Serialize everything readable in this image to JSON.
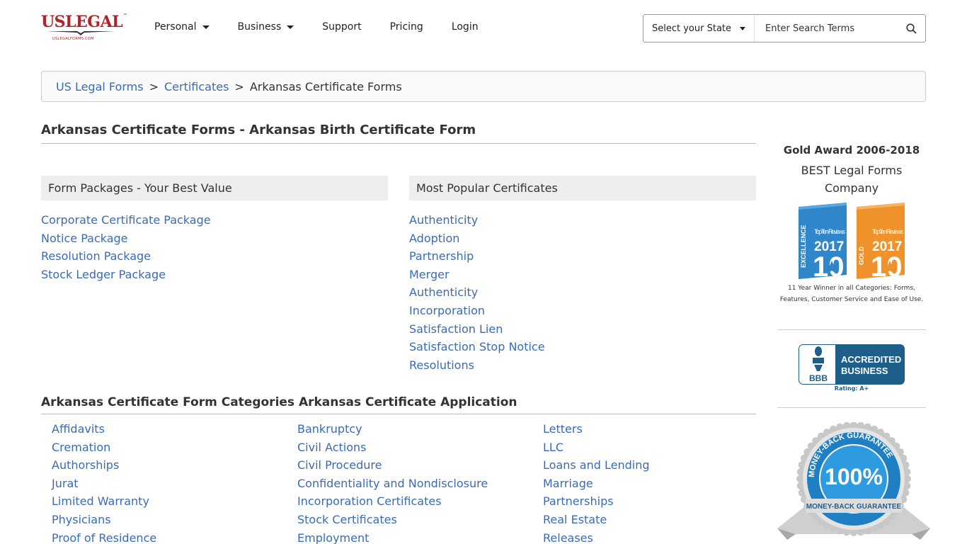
{
  "header": {
    "logo": {
      "text": "USLEGAL",
      "tm": "™",
      "sub": "USLEGALFORMS.COM"
    },
    "nav": [
      {
        "label": "Personal",
        "dropdown": true
      },
      {
        "label": "Business",
        "dropdown": true
      },
      {
        "label": "Support",
        "dropdown": false
      },
      {
        "label": "Pricing",
        "dropdown": false
      },
      {
        "label": "Login",
        "dropdown": false
      }
    ],
    "state_select": "Select your State",
    "search_placeholder": "Enter Search Terms",
    "search_icon": "search-icon"
  },
  "breadcrumb": {
    "items": [
      "US Legal Forms",
      "Certificates"
    ],
    "separator": ">",
    "current": "Arkansas Certificate Forms"
  },
  "main": {
    "title": "Arkansas Certificate Forms - Arkansas Birth Certificate Form",
    "packages": {
      "heading": "Form Packages - Your Best Value",
      "items": [
        "Corporate Certificate Package",
        "Notice Package",
        "Resolution Package",
        "Stock Ledger Package"
      ]
    },
    "popular": {
      "heading": "Most Popular Certificates",
      "items": [
        "Authenticity",
        "Adoption",
        "Partnership",
        "Merger",
        "Authenticity",
        "Incorporation",
        "Satisfaction Lien",
        "Satisfaction Stop Notice",
        "Resolutions"
      ]
    },
    "categories": {
      "heading": "Arkansas Certificate Form Categories Arkansas Certificate Application",
      "col1": [
        "Affidavits",
        "Cremation",
        "Authorships",
        "Jurat",
        "Limited Warranty",
        "Physicians",
        "Proof of Residence"
      ],
      "col2": [
        "Bankruptcy",
        "Civil Actions",
        "Civil Procedure",
        "Confidentiality and Nondisclosure",
        "Incorporation Certificates",
        "Stock Certificates",
        "Employment"
      ],
      "col3": [
        "Letters",
        "LLC",
        "Loans and Lending",
        "Marriage",
        "Partnerships",
        "Real Estate",
        "Releases"
      ]
    }
  },
  "sidebar": {
    "award_title": "Gold Award 2006-2018",
    "award_sub": "BEST Legal Forms Company",
    "badge_left": {
      "vertical": "EXCELLENCE",
      "brand": "TopTen Reviews",
      "year": "2017",
      "num": "10"
    },
    "badge_right": {
      "vertical": "GOLD",
      "brand": "TopTen Reviews",
      "year": "2017",
      "num": "10"
    },
    "award_note": "11 Year Winner in all Categories: Forms, Features, Customer Service and Ease of Use.",
    "bbb": {
      "logo": "BBB",
      "line1": "ACCREDITED",
      "line2": "BUSINESS",
      "rating": "Rating: A+"
    },
    "guarantee": {
      "pct": "100%",
      "ring": "MONEY-BACK GUARANTEE",
      "ribbon": "MONEY-BACK GUARANTEE"
    },
    "colors": {
      "brand_red": "#b0232a",
      "link_blue": "#3a6bb5",
      "bbb_blue": "#1d5f8a",
      "badge_blue": "#2f86c9",
      "badge_orange": "#f0922b"
    }
  }
}
